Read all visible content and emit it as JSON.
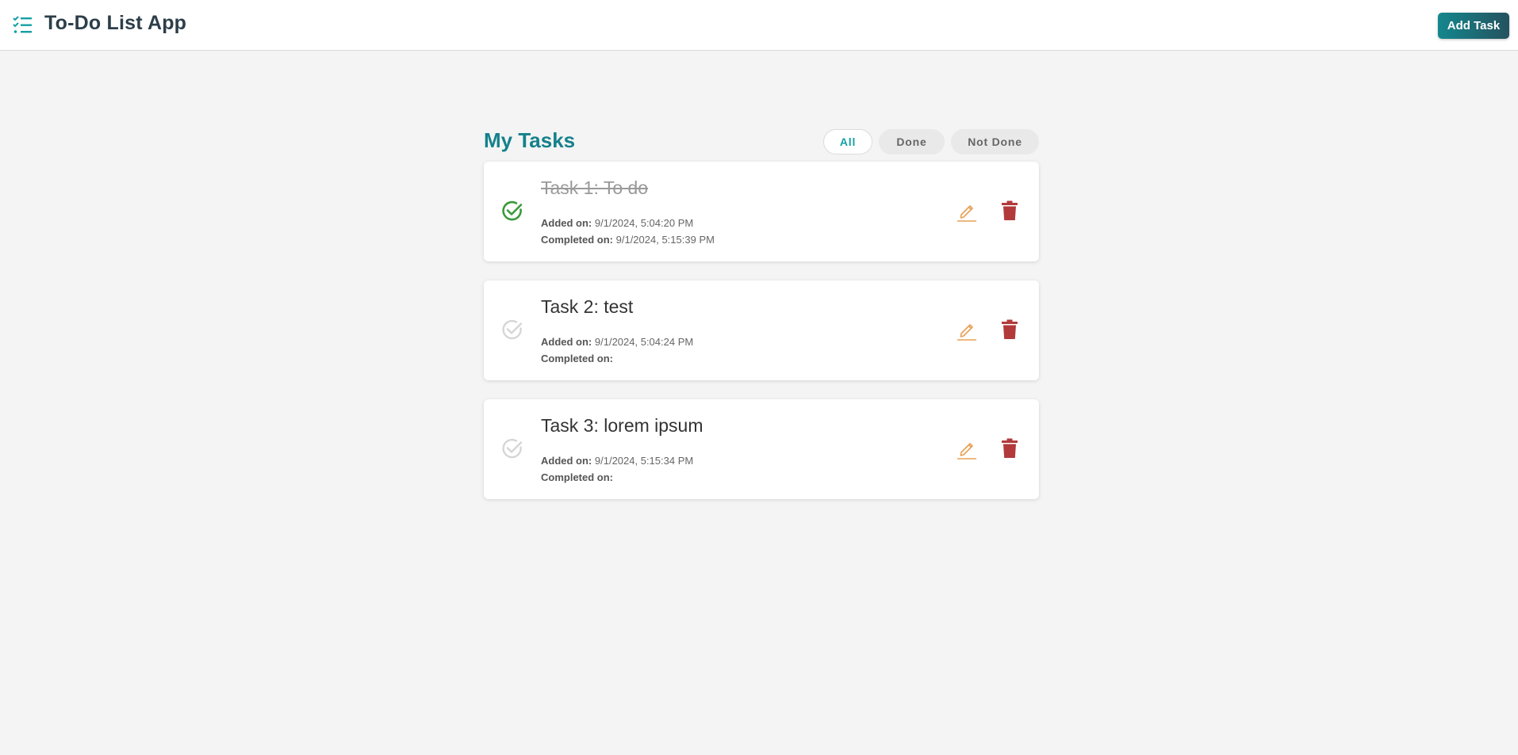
{
  "header": {
    "app_title": "To-Do List App",
    "add_task_label": "Add Task"
  },
  "main": {
    "section_title": "My Tasks",
    "filters": [
      {
        "label": "All",
        "selected": true
      },
      {
        "label": "Done",
        "selected": false
      },
      {
        "label": "Not Done",
        "selected": false
      }
    ],
    "added_label": "Added on:",
    "completed_label": "Completed on:",
    "tasks": [
      {
        "title": "Task 1: To do",
        "done": true,
        "added_on": "9/1/2024, 5:04:20 PM",
        "completed_on": "9/1/2024, 5:15:39 PM"
      },
      {
        "title": "Task 2: test",
        "done": false,
        "added_on": "9/1/2024, 5:04:24 PM",
        "completed_on": ""
      },
      {
        "title": "Task 3: lorem ipsum",
        "done": false,
        "added_on": "9/1/2024, 5:15:34 PM",
        "completed_on": ""
      }
    ]
  },
  "icons": {
    "brand": "checklist-icon",
    "check": "check-circle-icon",
    "edit": "pencil-icon",
    "delete": "trash-icon"
  },
  "colors": {
    "accent": "#14818b",
    "done_check": "#3a9a3a",
    "pending_check": "#d6d6d6",
    "edit": "#e8a055",
    "delete": "#b23a3a"
  }
}
